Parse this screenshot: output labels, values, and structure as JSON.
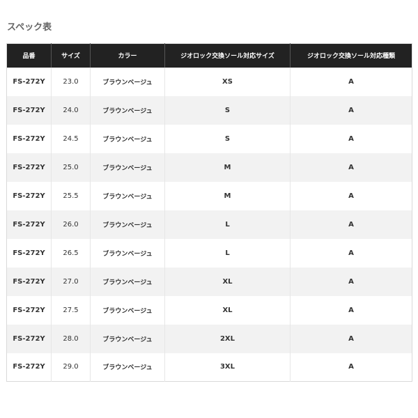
{
  "section": {
    "title": "スペック表"
  },
  "table": {
    "headers": [
      "品番",
      "サイズ",
      "カラー",
      "ジオロック交換ソール対応サイズ",
      "ジオロック交換ソール対応種類"
    ],
    "rows": [
      [
        "FS-272Y",
        "23.0",
        "ブラウンベージュ",
        "XS",
        "A"
      ],
      [
        "FS-272Y",
        "24.0",
        "ブラウンベージュ",
        "S",
        "A"
      ],
      [
        "FS-272Y",
        "24.5",
        "ブラウンベージュ",
        "S",
        "A"
      ],
      [
        "FS-272Y",
        "25.0",
        "ブラウンベージュ",
        "M",
        "A"
      ],
      [
        "FS-272Y",
        "25.5",
        "ブラウンベージュ",
        "M",
        "A"
      ],
      [
        "FS-272Y",
        "26.0",
        "ブラウンベージュ",
        "L",
        "A"
      ],
      [
        "FS-272Y",
        "26.5",
        "ブラウンベージュ",
        "L",
        "A"
      ],
      [
        "FS-272Y",
        "27.0",
        "ブラウンベージュ",
        "XL",
        "A"
      ],
      [
        "FS-272Y",
        "27.5",
        "ブラウンベージュ",
        "XL",
        "A"
      ],
      [
        "FS-272Y",
        "28.0",
        "ブラウンベージュ",
        "2XL",
        "A"
      ],
      [
        "FS-272Y",
        "29.0",
        "ブラウンベージュ",
        "3XL",
        "A"
      ]
    ]
  },
  "colors": {
    "header_bg": "#222222",
    "header_text": "#ffffff",
    "stripe_bg": "#f2f2f2",
    "title_text": "#666666"
  }
}
